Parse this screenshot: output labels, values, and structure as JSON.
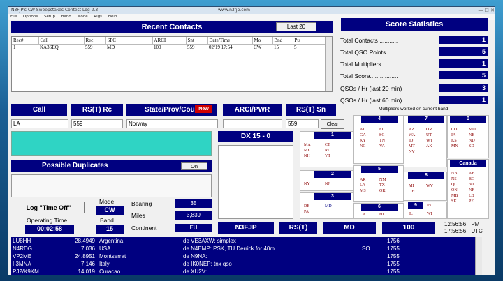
{
  "window": {
    "title": "N3FJP's CW Sweepstakes Contest Log 2.3",
    "titlebar_right": "www.n3fjp.com",
    "controls": "— ☐ ✕"
  },
  "menu": [
    "File",
    "Options",
    "Setup",
    "Band",
    "Mode",
    "Rigs",
    "Help"
  ],
  "recent_contacts": {
    "title": "Recent Contacts",
    "last20_label": "Last 20",
    "columns": [
      "Rec#",
      "Call",
      "Rec",
      "SPC",
      "ARCI",
      "Snt",
      "Date/Time",
      "Mo",
      "Bnd",
      "Pts"
    ],
    "rows": [
      [
        "1",
        "KA3SEQ",
        "559",
        "MD",
        "100",
        "559",
        "02/19 17:54",
        "CW",
        "15",
        "5"
      ]
    ]
  },
  "score": {
    "title": "Score Statistics",
    "items": [
      {
        "label": "Total Contacts ...........",
        "value": "1"
      },
      {
        "label": "Total QSO Points .........",
        "value": "5"
      },
      {
        "label": "Total Multipliers ...........",
        "value": "1"
      },
      {
        "label": "Total Score.................",
        "value": "5"
      },
      {
        "label": "QSOs / Hr (last 20 min)",
        "value": "3"
      },
      {
        "label": "QSOs / Hr (last 60 min)",
        "value": "1"
      }
    ]
  },
  "entry": {
    "call_label": "Call",
    "rst_rc_label": "RS(T) Rc",
    "spc_label": "State/Prov/Cou",
    "new_badge": "New",
    "arci_label": "ARCI/PWR",
    "rst_sn_label": "RS(T) Sn",
    "call_value": "LA",
    "rst_rc_value": "559",
    "spc_value": "Norway",
    "arci_value": "",
    "rst_sn_value": "559",
    "clear_label": "Clear"
  },
  "dup": {
    "title": "Possible Duplicates",
    "toggle": "On"
  },
  "dx": {
    "title": "DX 15 - 0"
  },
  "multipliers": {
    "header": "Multipliers worked on current band:",
    "districts": [
      {
        "num": "1",
        "items": [
          "MA",
          "CT",
          "ME",
          "RI",
          "NH",
          "VT"
        ]
      },
      {
        "num": "2",
        "items": [
          "NY",
          "NJ"
        ]
      },
      {
        "num": "3",
        "items": [
          "DE",
          "MD",
          "PA",
          ""
        ]
      },
      {
        "num": "4",
        "items": [
          "AL",
          "FL",
          "GA",
          "SC",
          "KY",
          "TN",
          "NC",
          "VA"
        ]
      },
      {
        "num": "5",
        "items": [
          "AR",
          "NM",
          "LA",
          "TX",
          "MS",
          "OK"
        ]
      },
      {
        "num": "6",
        "items": [
          "CA",
          "HI"
        ]
      },
      {
        "num": "7",
        "items": [
          "AZ",
          "OR",
          "WA",
          "UT",
          "ID",
          "WY",
          "MT",
          "AK",
          "NV",
          ""
        ]
      },
      {
        "num": "8",
        "items": [
          "MI",
          "WV",
          "OH",
          ""
        ]
      },
      {
        "num": "9",
        "items": [
          "IN",
          "IL",
          "WI"
        ]
      },
      {
        "num": "0",
        "items": [
          "CO",
          "MO",
          "IA",
          "NE",
          "KS",
          "ND",
          "MN",
          "SD"
        ]
      },
      {
        "num": "Canada",
        "items": [
          "NB",
          "AB",
          "NS",
          "BC",
          "QC",
          "NT",
          "ON",
          "NF",
          "MB",
          "LB",
          "SK",
          "PE"
        ]
      }
    ]
  },
  "bottom": {
    "log_time_off": "Log \"Time Off\"",
    "operating_time_label": "Operating Time",
    "operating_time": "00:02:58",
    "mode_label": "Mode",
    "mode": "CW",
    "band_label": "Band",
    "band": "15",
    "bearing_label": "Bearing",
    "bearing": "35",
    "miles_label": "Miles",
    "miles": "3,839",
    "continent_label": "Continent",
    "continent": "EU",
    "n3fjp": "N3FJP",
    "rst": "RS(T)",
    "md": "MD",
    "power": "100",
    "time_local": "12:56:56",
    "time_local_suffix": "PM",
    "time_utc": "17:56:56",
    "time_utc_suffix": "UTC"
  },
  "spots": [
    [
      "LU8HH",
      "28.4949",
      "Argentina",
      "de VE3AXW:  simplex",
      "",
      "1756"
    ],
    [
      "N4RDG",
      "7.036",
      "USA",
      "de N4EMP:  PSK, TU Derrick for 40m",
      "SO",
      "1755"
    ],
    [
      "VP2ME",
      "24.8951",
      "Montserrat",
      "de N9NA:",
      "",
      "1755"
    ],
    [
      "II3MNA",
      "7.146",
      "Italy",
      "de IK0NEP:  tnx qso",
      "",
      "1755"
    ],
    [
      "PJ2/K9KM",
      "14.019",
      "Curacao",
      "de XU2V:",
      "",
      "1755"
    ]
  ]
}
